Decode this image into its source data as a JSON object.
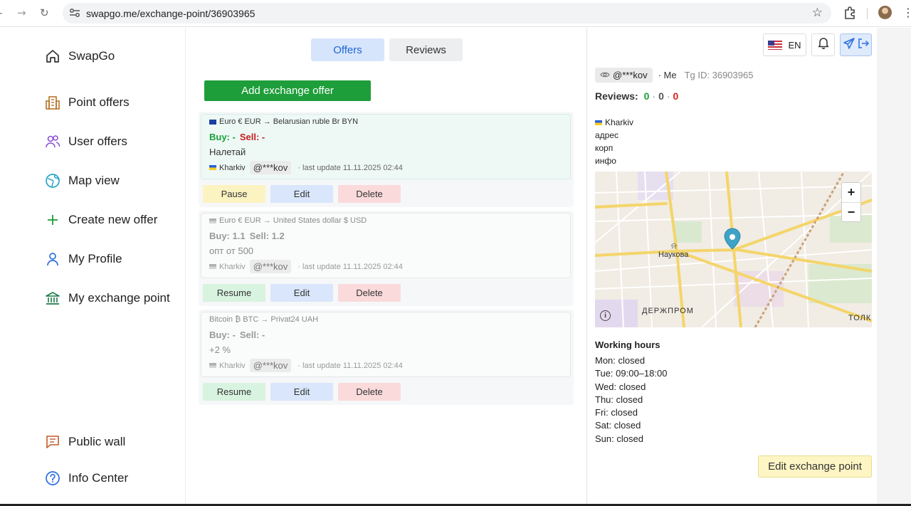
{
  "browser": {
    "url": "swapgo.me/exchange-point/36903965"
  },
  "sidebar": {
    "brand": "SwapGo",
    "items": [
      {
        "label": "Point offers",
        "icon": "building-icon"
      },
      {
        "label": "User offers",
        "icon": "users-icon"
      },
      {
        "label": "Map view",
        "icon": "globe-icon"
      },
      {
        "label": "Create new offer",
        "icon": "plus-icon"
      },
      {
        "label": "My Profile",
        "icon": "user-icon"
      },
      {
        "label": "My exchange point",
        "icon": "bank-icon"
      }
    ],
    "bottom": [
      {
        "label": "Public wall",
        "icon": "message-icon"
      },
      {
        "label": "Info Center",
        "icon": "help-icon"
      }
    ]
  },
  "tabs": {
    "offers": "Offers",
    "reviews": "Reviews"
  },
  "add_offer": "Add exchange offer",
  "offers": [
    {
      "pair": "Euro € EUR → Belarusian ruble Br BYN",
      "buy": "Buy: -",
      "sell": "Sell: -",
      "comment": "Налетай",
      "city": "Kharkiv",
      "user": "@***kov",
      "updated": "· last update 11.11.2025 02:44",
      "actions": {
        "toggle": "Pause",
        "edit": "Edit",
        "delete": "Delete"
      }
    },
    {
      "pair": "Euro € EUR → United States dollar $ USD",
      "buy": "Buy: 1.1",
      "sell": "Sell: 1.2",
      "comment": "опт от 500",
      "city": "Kharkiv",
      "user": "@***kov",
      "updated": "· last update 11.11.2025 02:44",
      "actions": {
        "toggle": "Resume",
        "edit": "Edit",
        "delete": "Delete"
      }
    },
    {
      "pair": "Bitcoin ₿ BTC → Privat24 UAH",
      "buy": "Buy: -",
      "sell": "Sell: -",
      "comment": "+2 %",
      "city": "Kharkiv",
      "user": "@***kov",
      "updated": "· last update 11.11.2025 02:44",
      "actions": {
        "toggle": "Resume",
        "edit": "Edit",
        "delete": "Delete"
      }
    }
  ],
  "header": {
    "lang": "EN"
  },
  "profile": {
    "user": "@***kov",
    "me": "· Me",
    "tg": "Tg ID: 36903965",
    "reviews_label": "Reviews:",
    "reviews_pos": "0",
    "reviews_neu": "0",
    "reviews_neg": "0",
    "city": "Kharkiv",
    "address": [
      "адрес",
      "корп",
      "инфо"
    ]
  },
  "map": {
    "labels": {
      "station": "Наукова",
      "district": "ДЕРЖПРОМ",
      "edge": "ТОЛК"
    }
  },
  "working_hours": {
    "title": "Working hours",
    "days": [
      "Mon: closed",
      "Tue: 09:00–18:00",
      "Wed: closed",
      "Thu: closed",
      "Fri: closed",
      "Sat: closed",
      "Sun: closed"
    ]
  },
  "edit_point": "Edit exchange point"
}
